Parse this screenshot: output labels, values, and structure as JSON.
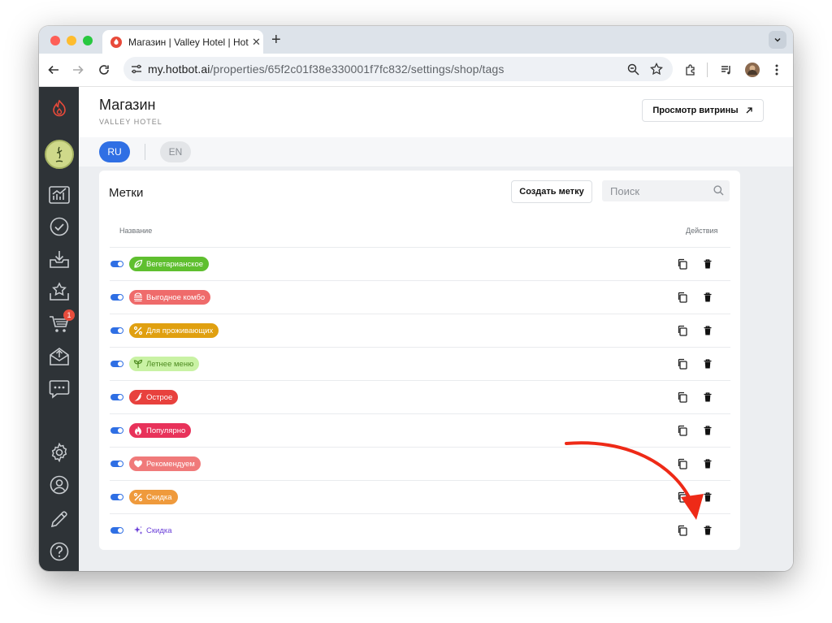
{
  "browser": {
    "tab_title": "Магазин | Valley Hotel | Hotbot",
    "url_host": "my.hotbot.ai",
    "url_path": "/properties/65f2c01f38e330001f7fc832/settings/shop/tags"
  },
  "colors": {
    "accent": "#2f6fe4",
    "sidebar": "#2e3337",
    "annotation_arrow": "#ee2a17"
  },
  "sidebar": {
    "items": [
      "flame-logo",
      "avatar",
      "analytics",
      "tasks",
      "inbox",
      "reviews",
      "cart",
      "mailings",
      "chat",
      "settings",
      "profile",
      "edit",
      "help"
    ],
    "cart_badge": "1"
  },
  "header": {
    "title": "Магазин",
    "subtitle": "VALLEY HOTEL",
    "storefront_button": "Просмотр витрины"
  },
  "languages": {
    "active": "RU",
    "inactive": "EN"
  },
  "tags_card": {
    "title": "Метки",
    "create_button": "Создать метку",
    "search_placeholder": "Поиск",
    "columns": {
      "name": "Название",
      "actions": "Действия"
    },
    "rows": [
      {
        "label": "Вегетарианское",
        "icon": "leaf-icon",
        "color": "#5fbf2f",
        "text_color": "#ffffff",
        "enabled": true
      },
      {
        "label": "Выгодное комбо",
        "icon": "burger-combo-icon",
        "color": "#ef6b6b",
        "text_color": "#ffffff",
        "enabled": true
      },
      {
        "label": "Для проживающих",
        "icon": "percent-icon",
        "color": "#e0a010",
        "text_color": "#ffffff",
        "enabled": true
      },
      {
        "label": "Летнее меню",
        "icon": "sprout-icon",
        "color": "#c9f2a4",
        "text_color": "#4c8a1f",
        "enabled": true
      },
      {
        "label": "Острое",
        "icon": "chili-icon",
        "color": "#e8413d",
        "text_color": "#ffffff",
        "enabled": true
      },
      {
        "label": "Популярно",
        "icon": "fire-icon",
        "color": "#e8325a",
        "text_color": "#ffffff",
        "enabled": true
      },
      {
        "label": "Рекомендуем",
        "icon": "heart-icon",
        "color": "#f07a7a",
        "text_color": "#ffffff",
        "enabled": true
      },
      {
        "label": "Скидка",
        "icon": "percent-icon",
        "color": "#ef9a3c",
        "text_color": "#ffffff",
        "enabled": true
      },
      {
        "label": "Скидка",
        "icon": "sparkle-icon",
        "color": "#ffffff",
        "text_color": "#6a3fd8",
        "enabled": true
      }
    ]
  }
}
